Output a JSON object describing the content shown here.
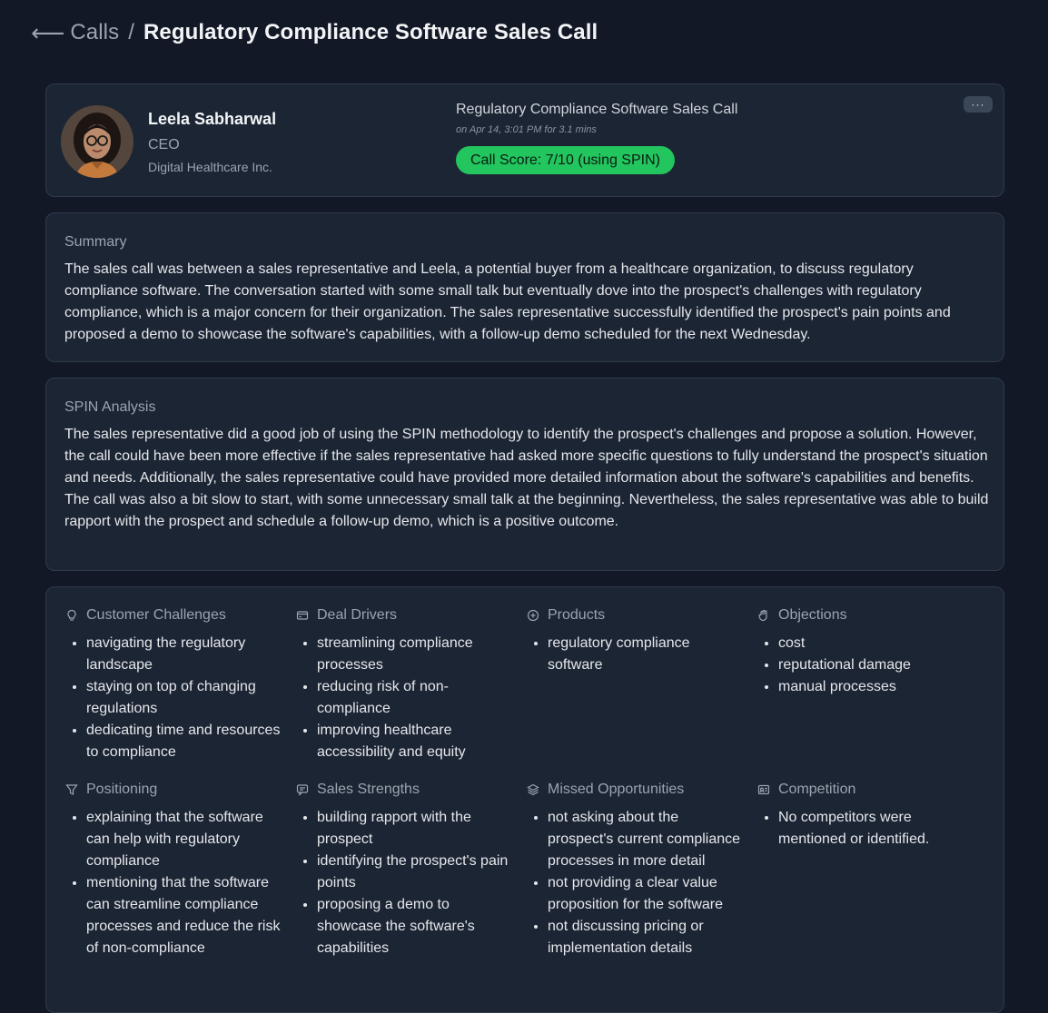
{
  "breadcrumb": {
    "back_icon": "arrow-left-icon",
    "parent": "Calls",
    "separator": "/",
    "current": "Regulatory Compliance Software Sales Call"
  },
  "header": {
    "contact": {
      "name": "Leela Sabharwal",
      "title": "CEO",
      "company": "Digital Healthcare Inc."
    },
    "call": {
      "title": "Regulatory Compliance Software Sales Call",
      "meta": "on Apr 14, 3:01 PM for 3.1 mins",
      "score": "Call Score: 7/10 (using SPIN)",
      "score_color": "#22c55e"
    },
    "more_label": "···"
  },
  "summary": {
    "heading": "Summary",
    "body": "The sales call was between a sales representative and Leela, a potential buyer from a healthcare organization, to discuss regulatory compliance software. The conversation started with some small talk but eventually dove into the prospect's challenges with regulatory compliance, which is a major concern for their organization. The sales representative successfully identified the prospect's pain points and proposed a demo to showcase the software's capabilities, with a follow-up demo scheduled for the next Wednesday."
  },
  "spin": {
    "heading": "SPIN Analysis",
    "body": "The sales representative did a good job of using the SPIN methodology to identify the prospect's challenges and propose a solution. However, the call could have been more effective if the sales representative had asked more specific questions to fully understand the prospect's situation and needs. Additionally, the sales representative could have provided more detailed information about the software's capabilities and benefits. The call was also a bit slow to start, with some unnecessary small talk at the beginning. Nevertheless, the sales representative was able to build rapport with the prospect and schedule a follow-up demo, which is a positive outcome."
  },
  "insights": [
    {
      "title": "Customer Challenges",
      "icon": "lightbulb-icon",
      "items": [
        "navigating the regulatory landscape",
        "staying on top of changing regulations",
        "dedicating time and resources to compliance"
      ]
    },
    {
      "title": "Deal Drivers",
      "icon": "credit-card-icon",
      "items": [
        "streamlining compliance processes",
        "reducing risk of non-compliance",
        "improving healthcare accessibility and equity"
      ]
    },
    {
      "title": "Products",
      "icon": "plus-circle-icon",
      "items": [
        "regulatory compliance software"
      ]
    },
    {
      "title": "Objections",
      "icon": "hand-icon",
      "items": [
        "cost",
        "reputational damage",
        "manual processes"
      ]
    },
    {
      "title": "Positioning",
      "icon": "filter-icon",
      "items": [
        "explaining that the software can help with regulatory compliance",
        "mentioning that the software can streamline compliance processes and reduce the risk of non-compliance"
      ]
    },
    {
      "title": "Sales Strengths",
      "icon": "chat-icon",
      "items": [
        "building rapport with the prospect",
        "identifying the prospect's pain points",
        "proposing a demo to showcase the software's capabilities"
      ]
    },
    {
      "title": "Missed Opportunities",
      "icon": "layers-icon",
      "items": [
        "not asking about the prospect's current compliance processes in more detail",
        "not providing a clear value proposition for the software",
        "not discussing pricing or implementation details"
      ]
    },
    {
      "title": "Competition",
      "icon": "id-card-icon",
      "items": [
        "No competitors were mentioned or identified."
      ]
    }
  ]
}
